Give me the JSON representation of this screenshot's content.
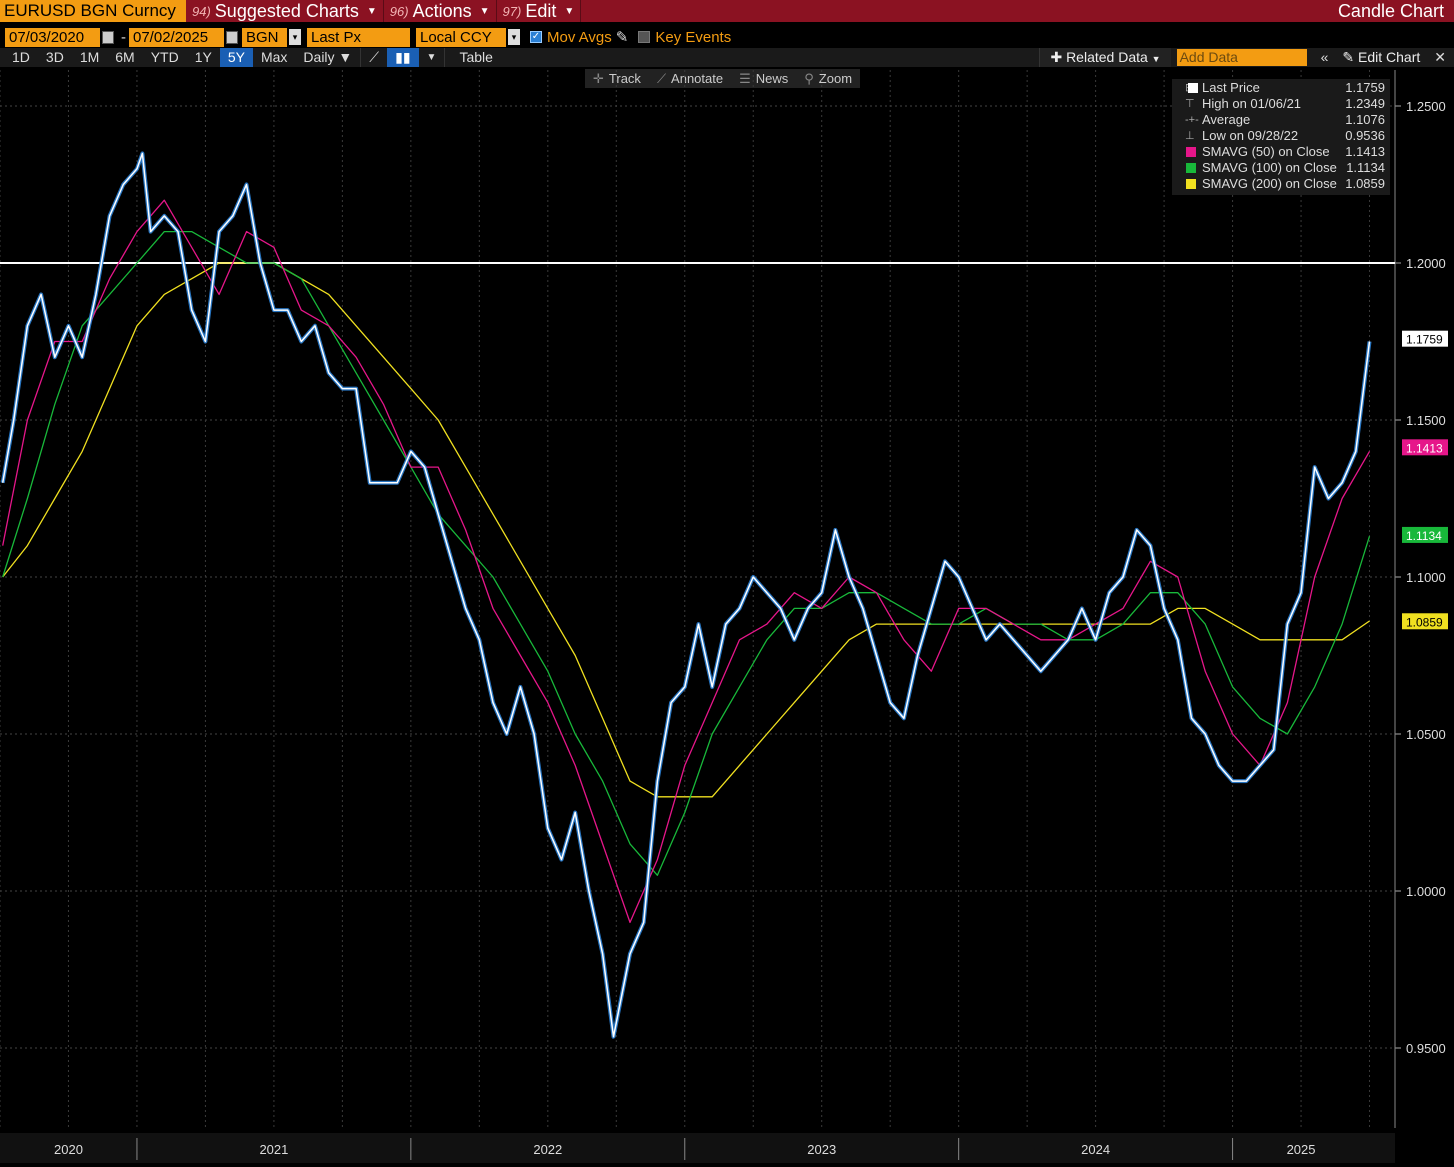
{
  "header": {
    "ticker": "EURUSD BGN Curncy",
    "menus": [
      {
        "num": "94)",
        "label": "Suggested Charts"
      },
      {
        "num": "96)",
        "label": "Actions"
      },
      {
        "num": "97)",
        "label": "Edit"
      }
    ],
    "chart_type": "Candle Chart"
  },
  "controls": {
    "start_date": "07/03/2020",
    "end_date": "07/02/2025",
    "source": "BGN",
    "field": "Last Px",
    "currency": "Local CCY",
    "mov_avgs_label": "Mov Avgs",
    "key_events_label": "Key Events",
    "date_separator": "-"
  },
  "ranges": [
    "1D",
    "3D",
    "1M",
    "6M",
    "YTD",
    "1Y",
    "5Y",
    "Max"
  ],
  "active_range": "5Y",
  "frequency": "Daily",
  "table_label": "Table",
  "related_data_label": "Related Data",
  "add_data_placeholder": "Add Data",
  "edit_chart_label": "Edit Chart",
  "tools": [
    "Track",
    "Annotate",
    "News",
    "Zoom"
  ],
  "legend": [
    {
      "label": "Last Price",
      "value": "1.1759",
      "color": "#ffffff",
      "kind": "swatch"
    },
    {
      "label": "High on 01/06/21",
      "value": "1.2349",
      "kind": "high"
    },
    {
      "label": "Average",
      "value": "1.1076",
      "kind": "avg"
    },
    {
      "label": "Low on 09/28/22",
      "value": "0.9536",
      "kind": "low"
    },
    {
      "label": "SMAVG (50)  on Close",
      "value": "1.1413",
      "color": "#e6168a",
      "kind": "swatch"
    },
    {
      "label": "SMAVG (100)  on Close",
      "value": "1.1134",
      "color": "#18b83a",
      "kind": "swatch"
    },
    {
      "label": "SMAVG (200)  on Close",
      "value": "1.0859",
      "color": "#f0e020",
      "kind": "swatch"
    }
  ],
  "chart_data": {
    "type": "line",
    "title": "EURUSD BGN Curncy",
    "ylim": [
      0.925,
      1.26
    ],
    "y_ticks": [
      {
        "value": 0.95,
        "label": "0.9500"
      },
      {
        "value": 1.0,
        "label": "1.0000"
      },
      {
        "value": 1.05,
        "label": "1.0500"
      },
      {
        "value": 1.1,
        "label": "1.1000"
      },
      {
        "value": 1.15,
        "label": "1.1500"
      },
      {
        "value": 1.2,
        "label": "1.2000"
      },
      {
        "value": 1.25,
        "label": "1.2500"
      }
    ],
    "x_labels": [
      "2020",
      "2021",
      "2022",
      "2023",
      "2024",
      "2025"
    ],
    "x_label_positions": [
      2020.75,
      2021.5,
      2022.5,
      2023.5,
      2024.5,
      2025.25
    ],
    "xlim": [
      2020.5,
      2025.52
    ],
    "reference_line": 1.2,
    "last_value_labels": [
      {
        "value": 1.1759,
        "label": "1.1759",
        "bg": "#ffffff",
        "fg": "#000000"
      },
      {
        "value": 1.1413,
        "label": "1.1413",
        "bg": "#e6168a",
        "fg": "#ffffff"
      },
      {
        "value": 1.1134,
        "label": "1.1134",
        "bg": "#18b83a",
        "fg": "#ffffff"
      },
      {
        "value": 1.0859,
        "label": "1.0859",
        "bg": "#f0e020",
        "fg": "#000000"
      }
    ],
    "series": [
      {
        "name": "Last Price",
        "color": "#ffffff",
        "x": [
          2020.51,
          2020.55,
          2020.6,
          2020.65,
          2020.7,
          2020.75,
          2020.8,
          2020.85,
          2020.9,
          2020.95,
          2021.0,
          2021.02,
          2021.05,
          2021.1,
          2021.15,
          2021.2,
          2021.25,
          2021.3,
          2021.35,
          2021.4,
          2021.45,
          2021.5,
          2021.55,
          2021.6,
          2021.65,
          2021.7,
          2021.75,
          2021.8,
          2021.85,
          2021.9,
          2021.95,
          2022.0,
          2022.05,
          2022.1,
          2022.15,
          2022.2,
          2022.25,
          2022.3,
          2022.35,
          2022.4,
          2022.45,
          2022.5,
          2022.55,
          2022.6,
          2022.65,
          2022.7,
          2022.74,
          2022.8,
          2022.85,
          2022.9,
          2022.95,
          2023.0,
          2023.05,
          2023.1,
          2023.15,
          2023.2,
          2023.25,
          2023.3,
          2023.35,
          2023.4,
          2023.45,
          2023.5,
          2023.55,
          2023.6,
          2023.65,
          2023.7,
          2023.75,
          2023.8,
          2023.85,
          2023.9,
          2023.95,
          2024.0,
          2024.05,
          2024.1,
          2024.15,
          2024.2,
          2024.25,
          2024.3,
          2024.35,
          2024.4,
          2024.45,
          2024.5,
          2024.55,
          2024.6,
          2024.65,
          2024.7,
          2024.75,
          2024.8,
          2024.85,
          2024.9,
          2024.95,
          2025.0,
          2025.05,
          2025.1,
          2025.15,
          2025.2,
          2025.25,
          2025.3,
          2025.35,
          2025.4,
          2025.45,
          2025.5
        ],
        "y": [
          1.13,
          1.15,
          1.18,
          1.19,
          1.17,
          1.18,
          1.17,
          1.19,
          1.215,
          1.225,
          1.23,
          1.2349,
          1.21,
          1.215,
          1.21,
          1.185,
          1.175,
          1.21,
          1.215,
          1.225,
          1.2,
          1.185,
          1.185,
          1.175,
          1.18,
          1.165,
          1.16,
          1.16,
          1.13,
          1.13,
          1.13,
          1.14,
          1.135,
          1.12,
          1.105,
          1.09,
          1.08,
          1.06,
          1.05,
          1.065,
          1.05,
          1.02,
          1.01,
          1.025,
          1.0,
          0.98,
          0.9536,
          0.98,
          0.99,
          1.035,
          1.06,
          1.065,
          1.085,
          1.065,
          1.085,
          1.09,
          1.1,
          1.095,
          1.09,
          1.08,
          1.09,
          1.095,
          1.115,
          1.1,
          1.09,
          1.075,
          1.06,
          1.055,
          1.075,
          1.09,
          1.105,
          1.1,
          1.09,
          1.08,
          1.085,
          1.08,
          1.075,
          1.07,
          1.075,
          1.08,
          1.09,
          1.08,
          1.095,
          1.1,
          1.115,
          1.11,
          1.09,
          1.08,
          1.055,
          1.05,
          1.04,
          1.035,
          1.035,
          1.04,
          1.045,
          1.085,
          1.095,
          1.135,
          1.125,
          1.13,
          1.14,
          1.175
        ]
      },
      {
        "name": "SMAVG (50)",
        "color": "#e6168a",
        "x": [
          2020.51,
          2020.6,
          2020.7,
          2020.8,
          2020.9,
          2021.0,
          2021.1,
          2021.2,
          2021.3,
          2021.4,
          2021.5,
          2021.6,
          2021.7,
          2021.8,
          2021.9,
          2022.0,
          2022.1,
          2022.2,
          2022.3,
          2022.4,
          2022.5,
          2022.6,
          2022.7,
          2022.8,
          2022.9,
          2023.0,
          2023.1,
          2023.2,
          2023.3,
          2023.4,
          2023.5,
          2023.6,
          2023.7,
          2023.8,
          2023.9,
          2024.0,
          2024.1,
          2024.2,
          2024.3,
          2024.4,
          2024.5,
          2024.6,
          2024.7,
          2024.8,
          2024.9,
          2025.0,
          2025.1,
          2025.2,
          2025.3,
          2025.4,
          2025.5
        ],
        "y": [
          1.11,
          1.15,
          1.175,
          1.175,
          1.195,
          1.21,
          1.22,
          1.205,
          1.19,
          1.21,
          1.205,
          1.185,
          1.18,
          1.17,
          1.155,
          1.135,
          1.135,
          1.115,
          1.09,
          1.075,
          1.06,
          1.04,
          1.015,
          0.99,
          1.01,
          1.04,
          1.06,
          1.08,
          1.085,
          1.095,
          1.09,
          1.1,
          1.095,
          1.08,
          1.07,
          1.09,
          1.09,
          1.085,
          1.08,
          1.08,
          1.085,
          1.09,
          1.105,
          1.1,
          1.07,
          1.05,
          1.04,
          1.06,
          1.1,
          1.125,
          1.14
        ]
      },
      {
        "name": "SMAVG (100)",
        "color": "#18b83a",
        "x": [
          2020.51,
          2020.6,
          2020.7,
          2020.8,
          2020.9,
          2021.0,
          2021.1,
          2021.2,
          2021.3,
          2021.4,
          2021.5,
          2021.6,
          2021.7,
          2021.8,
          2021.9,
          2022.0,
          2022.1,
          2022.2,
          2022.3,
          2022.4,
          2022.5,
          2022.6,
          2022.7,
          2022.8,
          2022.9,
          2023.0,
          2023.1,
          2023.2,
          2023.3,
          2023.4,
          2023.5,
          2023.6,
          2023.7,
          2023.8,
          2023.9,
          2024.0,
          2024.1,
          2024.2,
          2024.3,
          2024.4,
          2024.5,
          2024.6,
          2024.7,
          2024.8,
          2024.9,
          2025.0,
          2025.1,
          2025.2,
          2025.3,
          2025.4,
          2025.5
        ],
        "y": [
          1.1,
          1.125,
          1.155,
          1.18,
          1.19,
          1.2,
          1.21,
          1.21,
          1.205,
          1.2,
          1.2,
          1.195,
          1.18,
          1.165,
          1.15,
          1.135,
          1.12,
          1.11,
          1.1,
          1.085,
          1.07,
          1.05,
          1.035,
          1.015,
          1.005,
          1.025,
          1.05,
          1.065,
          1.08,
          1.09,
          1.09,
          1.095,
          1.095,
          1.09,
          1.085,
          1.085,
          1.09,
          1.085,
          1.085,
          1.08,
          1.08,
          1.085,
          1.095,
          1.095,
          1.085,
          1.065,
          1.055,
          1.05,
          1.065,
          1.085,
          1.113
        ]
      },
      {
        "name": "SMAVG (200)",
        "color": "#f0e020",
        "x": [
          2020.51,
          2020.6,
          2020.7,
          2020.8,
          2020.9,
          2021.0,
          2021.1,
          2021.2,
          2021.3,
          2021.4,
          2021.5,
          2021.6,
          2021.7,
          2021.8,
          2021.9,
          2022.0,
          2022.1,
          2022.2,
          2022.3,
          2022.4,
          2022.5,
          2022.6,
          2022.7,
          2022.8,
          2022.9,
          2023.0,
          2023.1,
          2023.2,
          2023.3,
          2023.4,
          2023.5,
          2023.6,
          2023.7,
          2023.8,
          2023.9,
          2024.0,
          2024.1,
          2024.2,
          2024.3,
          2024.4,
          2024.5,
          2024.6,
          2024.7,
          2024.8,
          2024.9,
          2025.0,
          2025.1,
          2025.2,
          2025.3,
          2025.4,
          2025.5
        ],
        "y": [
          1.1,
          1.11,
          1.125,
          1.14,
          1.16,
          1.18,
          1.19,
          1.195,
          1.2,
          1.2,
          1.2,
          1.195,
          1.19,
          1.18,
          1.17,
          1.16,
          1.15,
          1.135,
          1.12,
          1.105,
          1.09,
          1.075,
          1.055,
          1.035,
          1.03,
          1.03,
          1.03,
          1.04,
          1.05,
          1.06,
          1.07,
          1.08,
          1.085,
          1.085,
          1.085,
          1.085,
          1.085,
          1.085,
          1.085,
          1.085,
          1.085,
          1.085,
          1.085,
          1.09,
          1.09,
          1.085,
          1.08,
          1.08,
          1.08,
          1.08,
          1.086
        ]
      }
    ]
  }
}
